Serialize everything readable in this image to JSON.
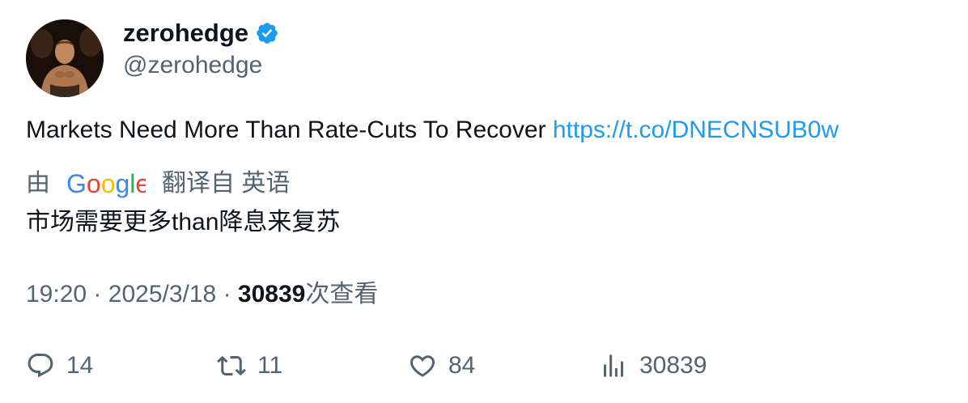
{
  "author": {
    "display_name": "zerohedge",
    "handle": "@zerohedge",
    "verified": true
  },
  "tweet": {
    "text": "Markets Need More Than Rate-Cuts To Recover",
    "link": "https://t.co/DNECNSUB0w"
  },
  "translation": {
    "prefix": "由",
    "provider": "Google",
    "suffix": "翻译自 英语",
    "text": "市场需要更多than降息来复苏"
  },
  "meta": {
    "time": "19:20",
    "separator": "·",
    "date": "2025/3/18",
    "views": "30839",
    "views_label": "次查看"
  },
  "actions": {
    "replies": "14",
    "reposts": "11",
    "likes": "84",
    "views": "30839"
  },
  "colors": {
    "link": "#1d9bf0",
    "secondary_text": "#536471",
    "primary_text": "#0f1419",
    "verified_badge": "#1d9bf0"
  },
  "icons": [
    "verified-badge-icon",
    "google-logo",
    "reply-icon",
    "repost-icon",
    "like-icon",
    "views-icon"
  ]
}
